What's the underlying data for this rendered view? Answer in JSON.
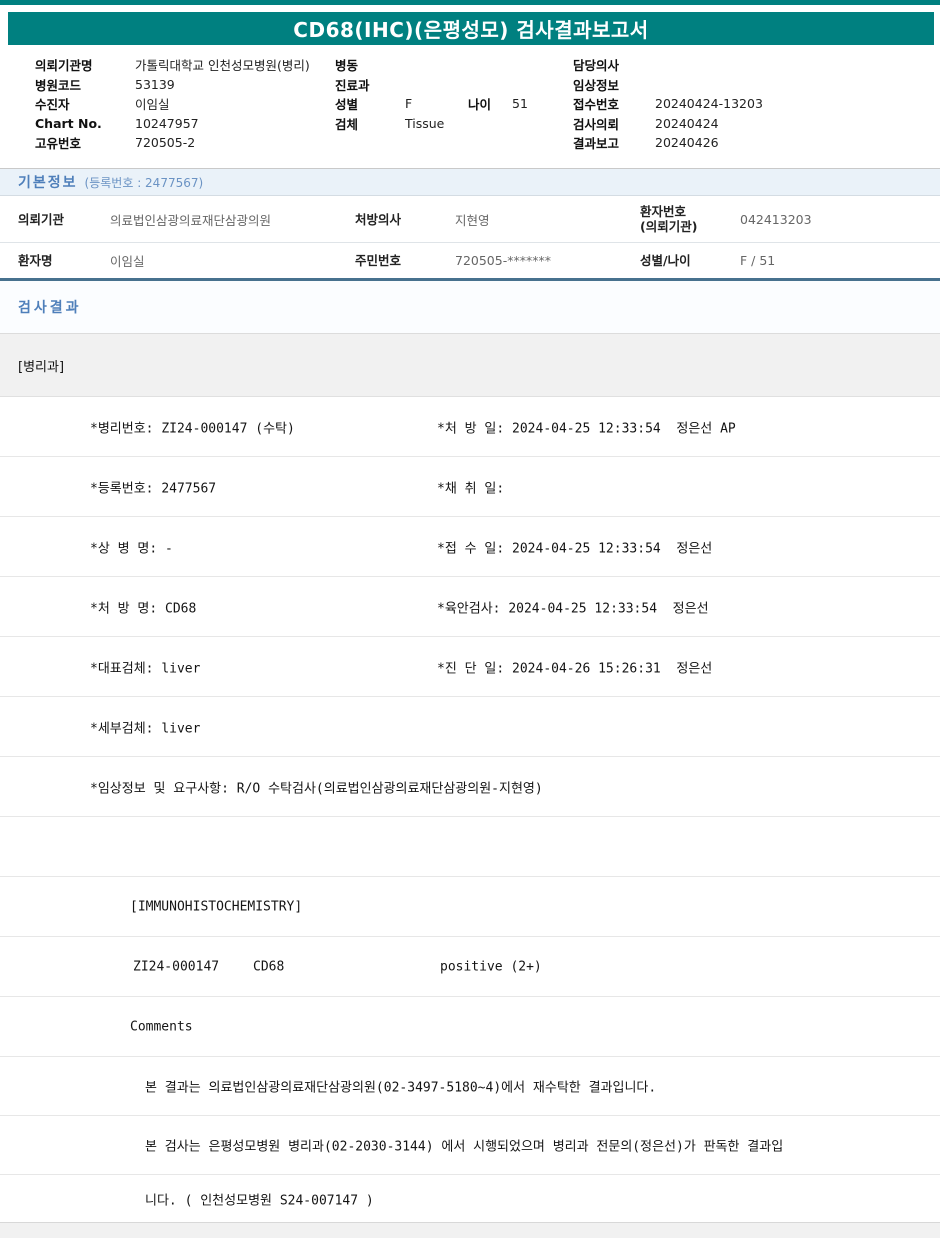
{
  "title": "CD68(IHC)(은평성모) 검사결과보고서",
  "header": {
    "left": [
      {
        "label": "의뢰기관명",
        "value": "가톨릭대학교 인천성모병원(병리)"
      },
      {
        "label": "병원코드",
        "value": "53139"
      },
      {
        "label": "수진자",
        "value": "이임실"
      },
      {
        "label": "Chart No.",
        "value": "10247957"
      },
      {
        "label": "고유번호",
        "value": "720505-2"
      }
    ],
    "middle": [
      {
        "label": "병동",
        "value": ""
      },
      {
        "label": "진료과",
        "value": ""
      },
      {
        "label": "성별",
        "value": "F",
        "label2": "나이",
        "value2": "51"
      },
      {
        "label": "검체",
        "value": "Tissue"
      }
    ],
    "right": [
      {
        "label": "담당의사",
        "value": ""
      },
      {
        "label": "임상정보",
        "value": ""
      },
      {
        "label": "접수번호",
        "value": "20240424-13203"
      },
      {
        "label": "검사의뢰",
        "value": "20240424"
      },
      {
        "label": "결과보고",
        "value": "20240426"
      }
    ]
  },
  "basic_info": {
    "section_title": "기본정보",
    "section_sub": "(등록번호 : 2477567)",
    "row1": {
      "label1": "의뢰기관",
      "value1": "의료법인삼광의료재단삼광의원",
      "label2": "처방의사",
      "value2": "지현영",
      "label3": "환자번호\n(의뢰기관)",
      "value3": "042413203"
    },
    "row2": {
      "label1": "환자명",
      "value1": "이임실",
      "label2": "주민번호",
      "value2": "720505-*******",
      "label3": "성별/나이",
      "value3": "F / 51"
    }
  },
  "results": {
    "section_title": "검사결과",
    "department": "[병리과]",
    "rows": [
      {
        "left": "*병리번호: ZI24-000147 (수탁)",
        "right": "*처 방 일: 2024-04-25 12:33:54  정은선 AP"
      },
      {
        "left": "*등록번호: 2477567",
        "right": "*채 취 일:"
      },
      {
        "left": "*상 병 명: -",
        "right": "*접 수 일: 2024-04-25 12:33:54  정은선"
      },
      {
        "left": "*처 방 명: CD68",
        "right": "*육안검사: 2024-04-25 12:33:54  정은선"
      },
      {
        "left": "*대표검체: liver",
        "right": "*진 단 일: 2024-04-26 15:26:31  정은선"
      },
      {
        "left": "*세부검체: liver",
        "right": ""
      },
      {
        "left": "*임상정보 및 요구사항: R/O 수탁검사(의료법인삼광의료재단삼광의원-지현영)",
        "right": ""
      },
      {
        "left": "",
        "right": ""
      }
    ],
    "ihc": {
      "header": "[IMMUNOHISTOCHEMISTRY]",
      "result": {
        "pathology_no": "ZI24-000147",
        "test_name": "CD68",
        "value": "positive (2+)"
      },
      "comments_label": "Comments",
      "comments": [
        "본 결과는 의료법인삼광의료재단삼광의원(02-3497-5180~4)에서 재수탁한 결과입니다.",
        "본 검사는 은평성모병원 병리과(02-2030-3144) 에서 시행되었으며 병리과 전문의(정은선)가 판독한 결과입",
        "니다. ( 인천성모병원 S24-007147 )"
      ]
    }
  }
}
